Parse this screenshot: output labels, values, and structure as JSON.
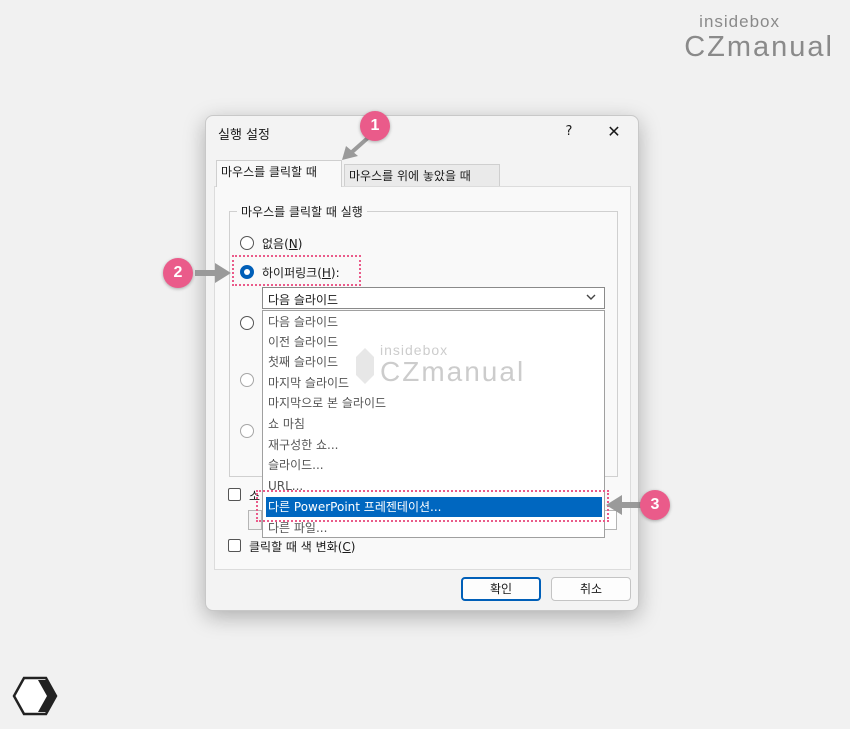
{
  "brand": {
    "tagline": "insidebox",
    "name": "CZmanual"
  },
  "dialog": {
    "title": "실행 설정",
    "help_label": "?",
    "close_label": "✕",
    "tabs": [
      {
        "label": "마우스를 클릭할 때"
      },
      {
        "label": "마우스를 위에 놓았을 때"
      }
    ],
    "group_title": "마우스를 클릭할 때 실행",
    "options": {
      "none_label": "없음(",
      "none_key": "N",
      "none_suffix": ")",
      "hyperlink_label": "하이퍼링크(",
      "hyperlink_key": "H",
      "hyperlink_suffix": "):"
    },
    "hyperlink_value": "다음 슬라이드",
    "hyperlink_options": [
      "다음 슬라이드",
      "이전 슬라이드",
      "첫째 슬라이드",
      "마지막 슬라이드",
      "마지막으로 본 슬라이드",
      "쇼 마침",
      "재구성한 쇼...",
      "슬라이드...",
      "URL...",
      "다른 PowerPoint 프레젠테이션...",
      "다른 파일..."
    ],
    "selected_option": "다른 PowerPoint 프레젠테이션...",
    "partial_checkbox_label": "소",
    "highlight_label": "클릭할 때 색 변화(",
    "highlight_key": "C",
    "highlight_suffix": ")",
    "ok_label": "확인",
    "cancel_label": "취소"
  },
  "annotations": {
    "m1": "1",
    "m2": "2",
    "m3": "3"
  },
  "colors": {
    "accent": "#005fb8",
    "selection": "#0067c0",
    "marker": "#ea5b8a"
  }
}
